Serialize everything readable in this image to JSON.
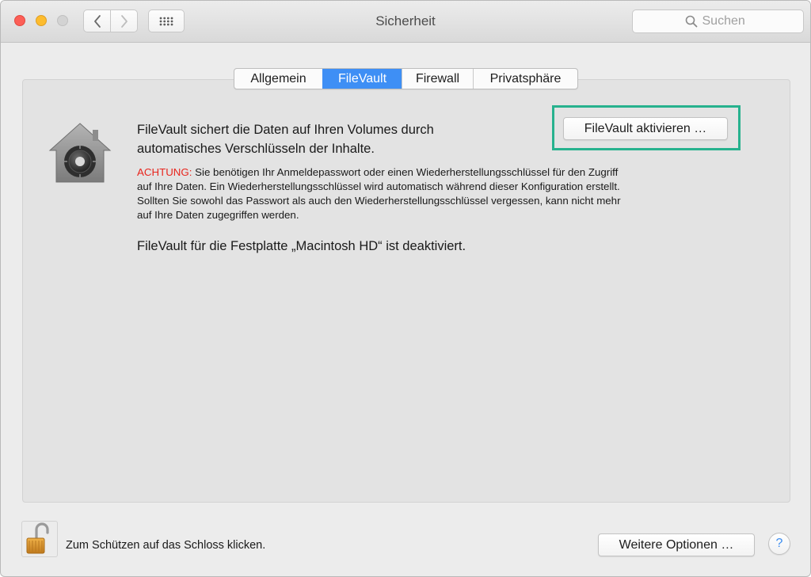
{
  "window": {
    "title": "Sicherheit"
  },
  "toolbar": {
    "back_icon": "chevron-left-icon",
    "forward_icon": "chevron-right-icon",
    "grid_icon": "grid-icon"
  },
  "search": {
    "placeholder": "Suchen"
  },
  "tabs": [
    {
      "label": "Allgemein",
      "active": false
    },
    {
      "label": "FileVault",
      "active": true
    },
    {
      "label": "Firewall",
      "active": false
    },
    {
      "label": "Privatsphäre",
      "active": false
    }
  ],
  "filevault": {
    "intro_line1": "FileVault sichert die Daten auf Ihren Volumes durch",
    "intro_line2": "automatisches Verschlüsseln der Inhalte.",
    "activate_button": "FileVault aktivieren …",
    "warning_label": "ACHTUNG:",
    "warning_line1": " Sie benötigen Ihr Anmeldepasswort oder einen Wiederherstellungsschlüssel für den Zugriff",
    "warning_line2": "auf Ihre Daten. Ein Wiederherstellungsschlüssel wird automatisch während dieser Konfiguration erstellt.",
    "warning_line3": "Sollten Sie sowohl das Passwort als auch den Wiederherstellungsschlüssel vergessen, kann nicht mehr",
    "warning_line4": "auf Ihre Daten zugegriffen werden.",
    "status": "FileVault für die Festplatte „Macintosh HD“ ist deaktiviert."
  },
  "footer": {
    "lock_label": "Zum Schützen auf das Schloss klicken.",
    "more_options_button": "Weitere Optionen …",
    "help_button": "?"
  },
  "colors": {
    "active_tab": "#3e8ff5",
    "warning": "#e8251d",
    "highlight": "#27b28e"
  }
}
